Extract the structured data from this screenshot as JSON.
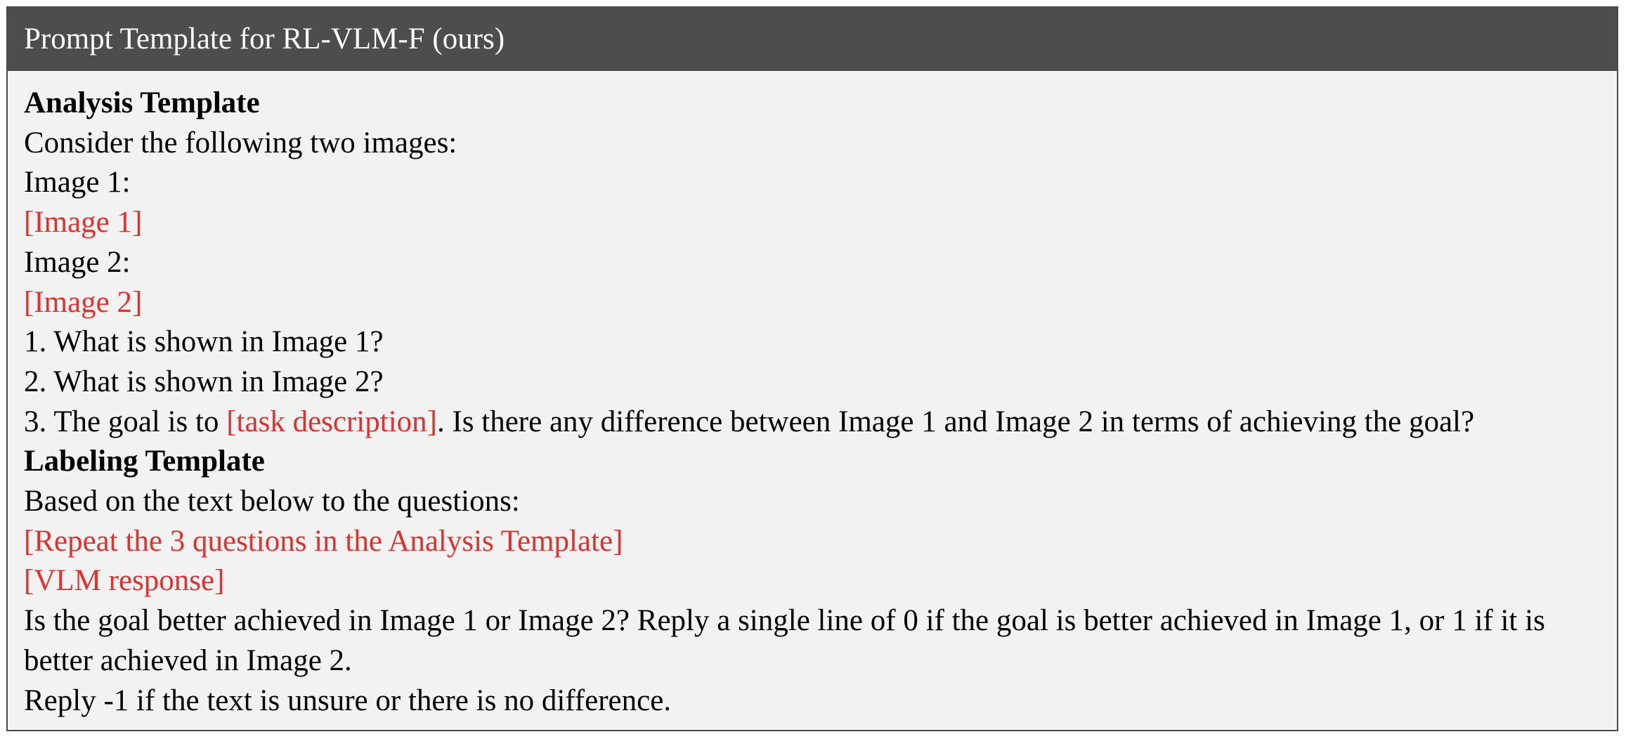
{
  "header": {
    "title": "Prompt Template for RL-VLM-F (ours)"
  },
  "analysis": {
    "heading": "Analysis Template",
    "intro": "Consider the following two images:",
    "image1_label": "Image 1:",
    "image1_placeholder": "[Image 1]",
    "image2_label": "Image 2:",
    "image2_placeholder": "[Image 2]",
    "q1": "1. What is shown in Image 1?",
    "q2": "2. What is shown in Image 2?",
    "q3_prefix": "3. The goal is to ",
    "q3_placeholder": "[task description]",
    "q3_suffix": ". Is there any difference between Image 1 and Image 2 in terms of achieving the goal?"
  },
  "labeling": {
    "heading": "Labeling Template",
    "intro": "Based on the text below to the questions:",
    "repeat_placeholder": "[Repeat the 3 questions in the Analysis Template]",
    "response_placeholder": "[VLM response]",
    "instruction": "Is the goal better achieved in Image 1 or Image 2? Reply a single line of 0 if the goal is better achieved in Image 1, or 1 if it is better achieved in Image 2.",
    "fallback": "Reply -1 if the text is unsure or there is no difference."
  },
  "colors": {
    "header_bg": "#4d4d4d",
    "box_bg": "#f2f2f2",
    "placeholder_red": "#e0312e"
  }
}
